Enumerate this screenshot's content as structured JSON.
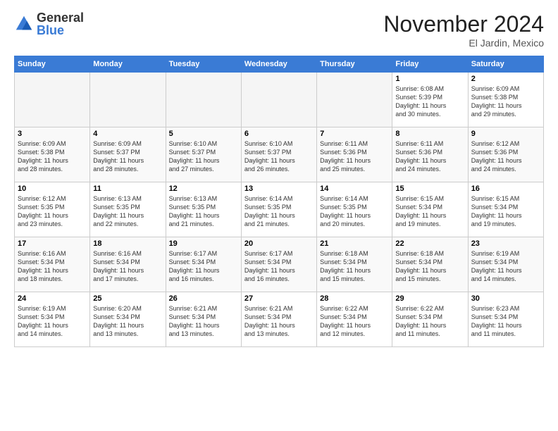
{
  "logo": {
    "general": "General",
    "blue": "Blue"
  },
  "header": {
    "title": "November 2024",
    "location": "El Jardin, Mexico"
  },
  "days_of_week": [
    "Sunday",
    "Monday",
    "Tuesday",
    "Wednesday",
    "Thursday",
    "Friday",
    "Saturday"
  ],
  "weeks": [
    [
      {
        "num": "",
        "info": "",
        "empty": true
      },
      {
        "num": "",
        "info": "",
        "empty": true
      },
      {
        "num": "",
        "info": "",
        "empty": true
      },
      {
        "num": "",
        "info": "",
        "empty": true
      },
      {
        "num": "",
        "info": "",
        "empty": true
      },
      {
        "num": "1",
        "info": "Sunrise: 6:08 AM\nSunset: 5:39 PM\nDaylight: 11 hours\nand 30 minutes."
      },
      {
        "num": "2",
        "info": "Sunrise: 6:09 AM\nSunset: 5:38 PM\nDaylight: 11 hours\nand 29 minutes."
      }
    ],
    [
      {
        "num": "3",
        "info": "Sunrise: 6:09 AM\nSunset: 5:38 PM\nDaylight: 11 hours\nand 28 minutes."
      },
      {
        "num": "4",
        "info": "Sunrise: 6:09 AM\nSunset: 5:37 PM\nDaylight: 11 hours\nand 28 minutes."
      },
      {
        "num": "5",
        "info": "Sunrise: 6:10 AM\nSunset: 5:37 PM\nDaylight: 11 hours\nand 27 minutes."
      },
      {
        "num": "6",
        "info": "Sunrise: 6:10 AM\nSunset: 5:37 PM\nDaylight: 11 hours\nand 26 minutes."
      },
      {
        "num": "7",
        "info": "Sunrise: 6:11 AM\nSunset: 5:36 PM\nDaylight: 11 hours\nand 25 minutes."
      },
      {
        "num": "8",
        "info": "Sunrise: 6:11 AM\nSunset: 5:36 PM\nDaylight: 11 hours\nand 24 minutes."
      },
      {
        "num": "9",
        "info": "Sunrise: 6:12 AM\nSunset: 5:36 PM\nDaylight: 11 hours\nand 24 minutes."
      }
    ],
    [
      {
        "num": "10",
        "info": "Sunrise: 6:12 AM\nSunset: 5:35 PM\nDaylight: 11 hours\nand 23 minutes."
      },
      {
        "num": "11",
        "info": "Sunrise: 6:13 AM\nSunset: 5:35 PM\nDaylight: 11 hours\nand 22 minutes."
      },
      {
        "num": "12",
        "info": "Sunrise: 6:13 AM\nSunset: 5:35 PM\nDaylight: 11 hours\nand 21 minutes."
      },
      {
        "num": "13",
        "info": "Sunrise: 6:14 AM\nSunset: 5:35 PM\nDaylight: 11 hours\nand 21 minutes."
      },
      {
        "num": "14",
        "info": "Sunrise: 6:14 AM\nSunset: 5:35 PM\nDaylight: 11 hours\nand 20 minutes."
      },
      {
        "num": "15",
        "info": "Sunrise: 6:15 AM\nSunset: 5:34 PM\nDaylight: 11 hours\nand 19 minutes."
      },
      {
        "num": "16",
        "info": "Sunrise: 6:15 AM\nSunset: 5:34 PM\nDaylight: 11 hours\nand 19 minutes."
      }
    ],
    [
      {
        "num": "17",
        "info": "Sunrise: 6:16 AM\nSunset: 5:34 PM\nDaylight: 11 hours\nand 18 minutes."
      },
      {
        "num": "18",
        "info": "Sunrise: 6:16 AM\nSunset: 5:34 PM\nDaylight: 11 hours\nand 17 minutes."
      },
      {
        "num": "19",
        "info": "Sunrise: 6:17 AM\nSunset: 5:34 PM\nDaylight: 11 hours\nand 16 minutes."
      },
      {
        "num": "20",
        "info": "Sunrise: 6:17 AM\nSunset: 5:34 PM\nDaylight: 11 hours\nand 16 minutes."
      },
      {
        "num": "21",
        "info": "Sunrise: 6:18 AM\nSunset: 5:34 PM\nDaylight: 11 hours\nand 15 minutes."
      },
      {
        "num": "22",
        "info": "Sunrise: 6:18 AM\nSunset: 5:34 PM\nDaylight: 11 hours\nand 15 minutes."
      },
      {
        "num": "23",
        "info": "Sunrise: 6:19 AM\nSunset: 5:34 PM\nDaylight: 11 hours\nand 14 minutes."
      }
    ],
    [
      {
        "num": "24",
        "info": "Sunrise: 6:19 AM\nSunset: 5:34 PM\nDaylight: 11 hours\nand 14 minutes."
      },
      {
        "num": "25",
        "info": "Sunrise: 6:20 AM\nSunset: 5:34 PM\nDaylight: 11 hours\nand 13 minutes."
      },
      {
        "num": "26",
        "info": "Sunrise: 6:21 AM\nSunset: 5:34 PM\nDaylight: 11 hours\nand 13 minutes."
      },
      {
        "num": "27",
        "info": "Sunrise: 6:21 AM\nSunset: 5:34 PM\nDaylight: 11 hours\nand 13 minutes."
      },
      {
        "num": "28",
        "info": "Sunrise: 6:22 AM\nSunset: 5:34 PM\nDaylight: 11 hours\nand 12 minutes."
      },
      {
        "num": "29",
        "info": "Sunrise: 6:22 AM\nSunset: 5:34 PM\nDaylight: 11 hours\nand 11 minutes."
      },
      {
        "num": "30",
        "info": "Sunrise: 6:23 AM\nSunset: 5:34 PM\nDaylight: 11 hours\nand 11 minutes."
      }
    ]
  ]
}
